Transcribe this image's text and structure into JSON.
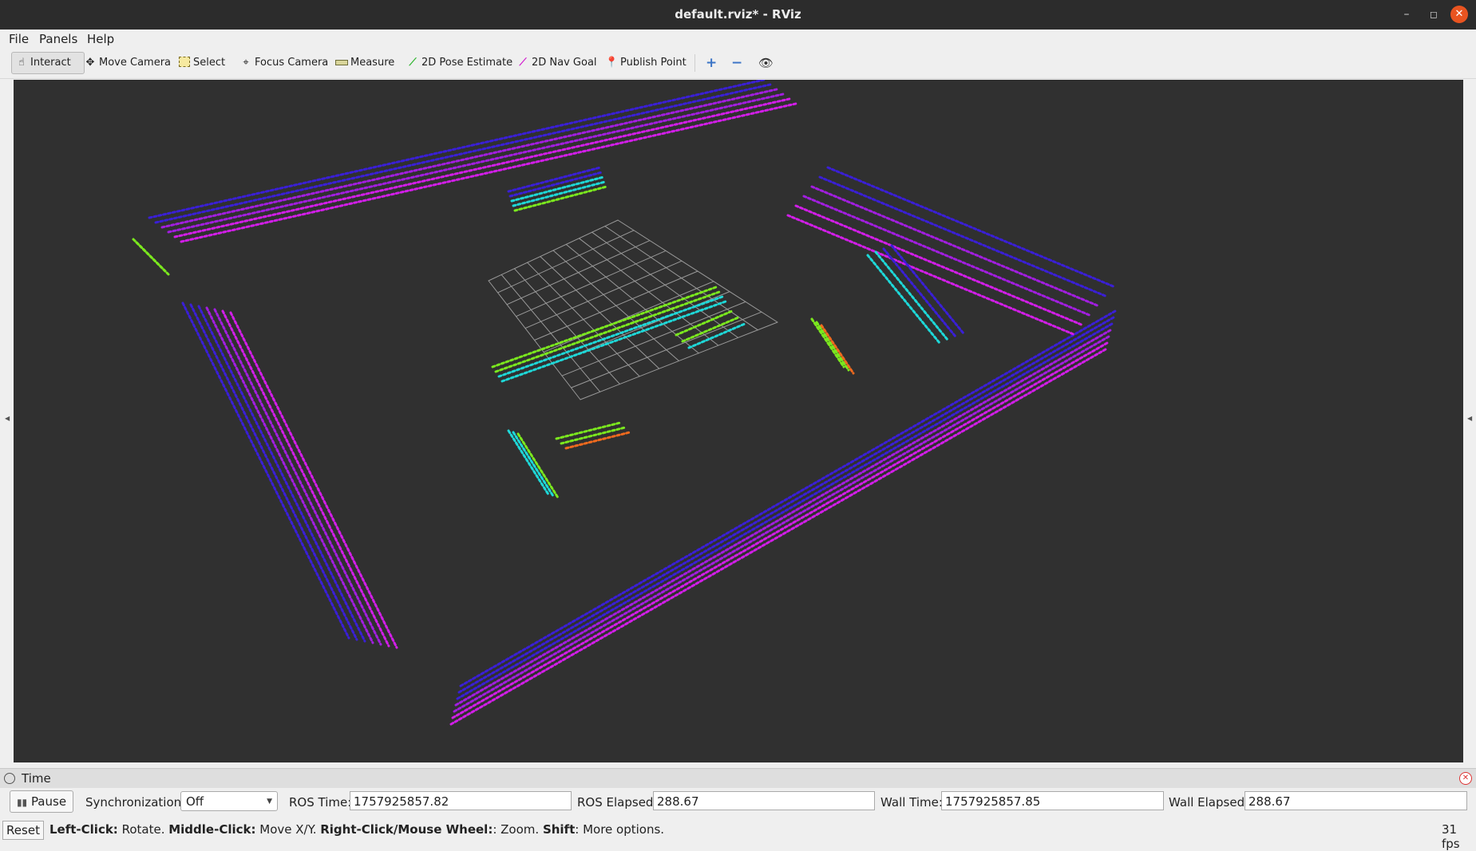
{
  "window": {
    "title": "default.rviz* - RViz",
    "minimize": "–",
    "maximize": "◻",
    "close": "✕"
  },
  "menu": {
    "file": "File",
    "panels": "Panels",
    "help": "Help"
  },
  "toolbar": {
    "interact": "Interact",
    "move_camera": "Move Camera",
    "select": "Select",
    "focus_camera": "Focus Camera",
    "measure": "Measure",
    "pose_estimate": "2D Pose Estimate",
    "nav_goal": "2D Nav Goal",
    "publish_point": "Publish Point"
  },
  "time_panel": {
    "title": "Time",
    "pause_label": "Pause",
    "sync_label": "Synchronization:",
    "sync_value": "Off",
    "ros_time_label": "ROS Time:",
    "ros_time_value": "1757925857.82",
    "ros_elapsed_label": "ROS Elapsed:",
    "ros_elapsed_value": "288.67",
    "wall_time_label": "Wall Time:",
    "wall_time_value": "1757925857.85",
    "wall_elapsed_label": "Wall Elapsed:",
    "wall_elapsed_value": "288.67"
  },
  "status": {
    "reset_label": "Reset",
    "hint_left_key": "Left-Click:",
    "hint_left": " Rotate. ",
    "hint_mid_key": "Middle-Click:",
    "hint_mid": " Move X/Y. ",
    "hint_right_key": "Right-Click/Mouse Wheel:",
    "hint_right": ": Zoom. ",
    "hint_shift_key": "Shift",
    "hint_shift": ": More options.",
    "fps": "31 fps"
  },
  "colors": {
    "viewport_bg": "#303030",
    "grid": "#9a9a9a",
    "scan_far": "#3a1fd6",
    "scan_mid": "#a21ee0",
    "scan_near": "#d21ee8",
    "scan_green": "#7be81e",
    "scan_cyan": "#1ed8d8",
    "scan_orange": "#f06a1e"
  }
}
